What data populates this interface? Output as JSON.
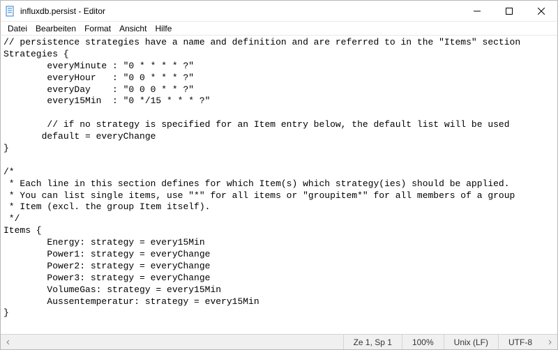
{
  "window": {
    "title": "influxdb.persist - Editor"
  },
  "menubar": {
    "items": [
      "Datei",
      "Bearbeiten",
      "Format",
      "Ansicht",
      "Hilfe"
    ]
  },
  "editor": {
    "content": "// persistence strategies have a name and definition and are referred to in the \"Items\" section\nStrategies {\n        everyMinute : \"0 * * * * ?\"\n        everyHour   : \"0 0 * * * ?\"\n        everyDay    : \"0 0 0 * * ?\"\n        every15Min  : \"0 */15 * * * ?\"\n\n        // if no strategy is specified for an Item entry below, the default list will be used\n       default = everyChange\n}\n\n/*\n * Each line in this section defines for which Item(s) which strategy(ies) should be applied.\n * You can list single items, use \"*\" for all items or \"groupitem*\" for all members of a group\n * Item (excl. the group Item itself).\n */\nItems {\n        Energy: strategy = every15Min\n        Power1: strategy = everyChange\n        Power2: strategy = everyChange\n        Power3: strategy = everyChange\n        VolumeGas: strategy = every15Min\n        Aussentemperatur: strategy = every15Min\n}"
  },
  "statusbar": {
    "position": "Ze 1, Sp 1",
    "zoom": "100%",
    "line_ending": "Unix (LF)",
    "encoding": "UTF-8"
  }
}
